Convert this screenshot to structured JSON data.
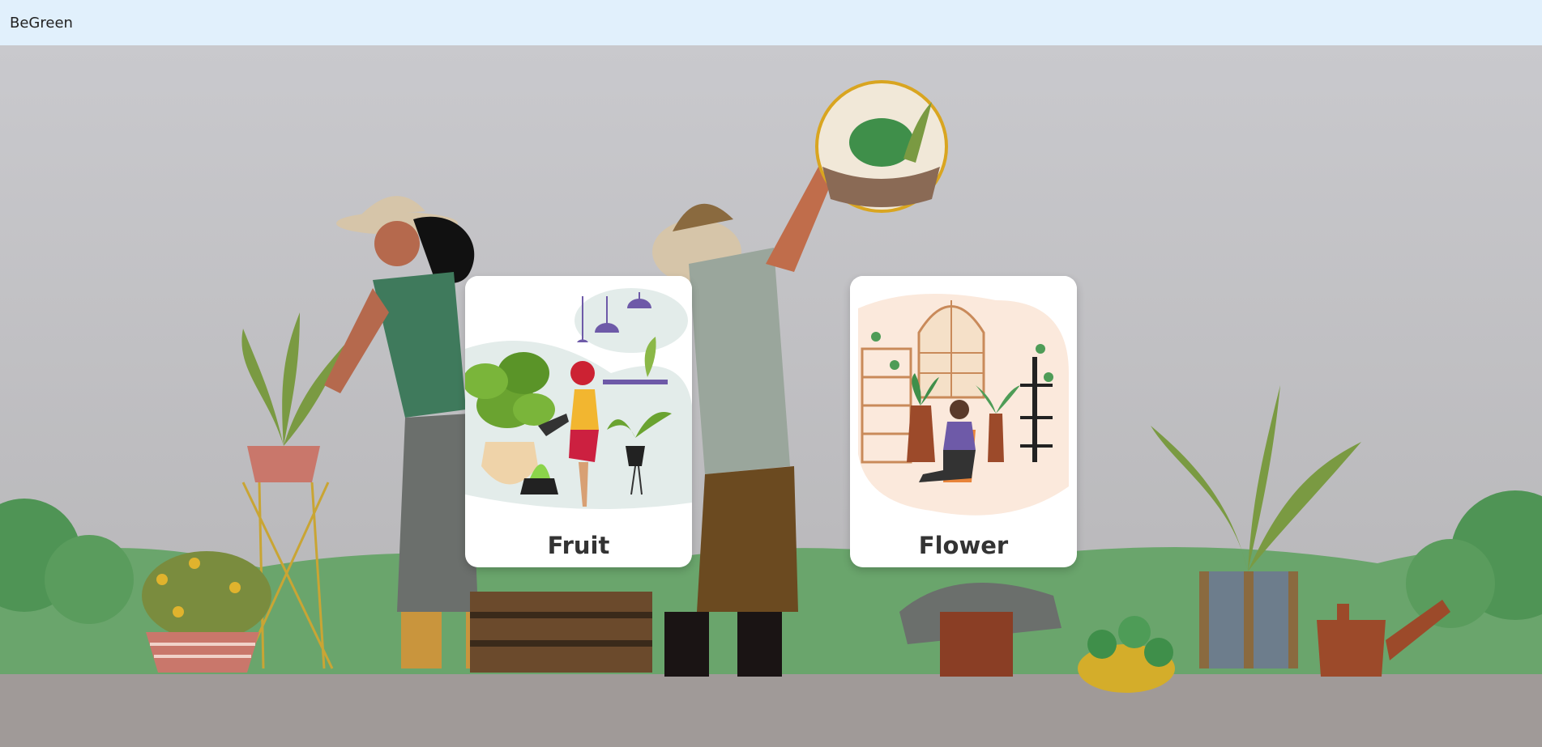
{
  "app": {
    "title": "BeGreen"
  },
  "cards": [
    {
      "label": "Fruit"
    },
    {
      "label": "Flower"
    }
  ],
  "colors": {
    "header_bg": "#e1f0fc",
    "sky": "#c9c9cc",
    "hill": "#6aa56c",
    "ground": "#a09a98"
  }
}
